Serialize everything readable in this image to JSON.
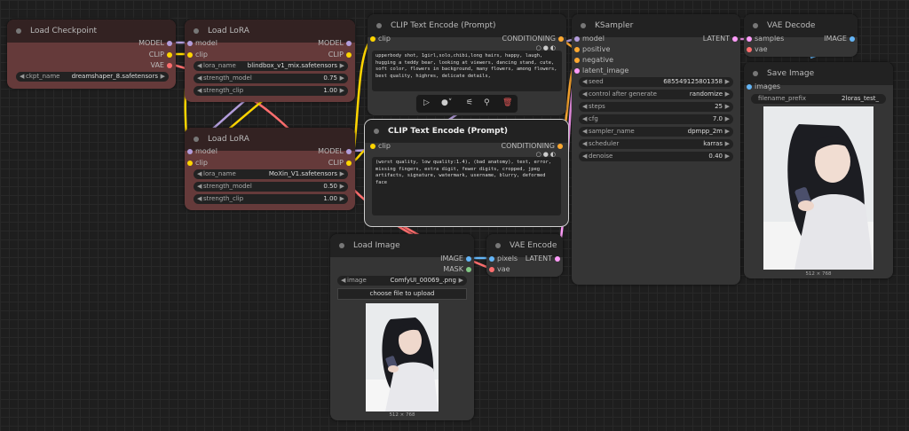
{
  "colors": {
    "model": "#b39ddb",
    "clip": "#ffd500",
    "vae": "#ff6e6e",
    "conditioning": "#ffa931",
    "latent": "#ff9cf9",
    "image": "#64b5f6",
    "mask": "#81c784"
  },
  "load_checkpoint": {
    "title": "Load Checkpoint",
    "outputs": [
      "MODEL",
      "CLIP",
      "VAE"
    ],
    "ckpt_label": "ckpt_name",
    "ckpt_value": "dreamshaper_8.safetensors"
  },
  "lora1": {
    "title": "Load LoRA",
    "inputs": [
      "model",
      "clip"
    ],
    "outputs": [
      "MODEL",
      "CLIP"
    ],
    "w": [
      {
        "label": "lora_name",
        "value": "blindbox_v1_mix.safetensors"
      },
      {
        "label": "strength_model",
        "value": "0.75"
      },
      {
        "label": "strength_clip",
        "value": "1.00"
      }
    ]
  },
  "lora2": {
    "title": "Load LoRA",
    "inputs": [
      "model",
      "clip"
    ],
    "outputs": [
      "MODEL",
      "CLIP"
    ],
    "w": [
      {
        "label": "lora_name",
        "value": "MoXin_V1.safetensors"
      },
      {
        "label": "strength_model",
        "value": "0.50"
      },
      {
        "label": "strength_clip",
        "value": "1.00"
      }
    ]
  },
  "clip_pos": {
    "title": "CLIP Text Encode (Prompt)",
    "input": "clip",
    "output": "CONDITIONING",
    "text": "upperbody shot, 1girl,solo,chibi,long hairs, happy, laugh, hugging a teddy bear, looking at viewers, dancing stand, cute, soft color, flowers in background, many flowers, among flowers, best quality, highres, delicate details,"
  },
  "clip_neg": {
    "title": "CLIP Text Encode (Prompt)",
    "input": "clip",
    "output": "CONDITIONING",
    "text": "(worst quality, low quality:1.4), (bad anatomy), text, error, missing fingers, extra digit, fewer digits, cropped, jpeg artifacts, signature, watermark, username, blurry, deformed face"
  },
  "ksampler": {
    "title": "KSampler",
    "inputs": [
      "model",
      "positive",
      "negative",
      "latent_image"
    ],
    "output": "LATENT",
    "w": [
      {
        "label": "seed",
        "value": "685549125801358"
      },
      {
        "label": "control after generate",
        "value": "randomize"
      },
      {
        "label": "steps",
        "value": "25"
      },
      {
        "label": "cfg",
        "value": "7.0"
      },
      {
        "label": "sampler_name",
        "value": "dpmpp_2m"
      },
      {
        "label": "scheduler",
        "value": "karras"
      },
      {
        "label": "denoise",
        "value": "0.40"
      }
    ]
  },
  "vae_decode": {
    "title": "VAE Decode",
    "inputs": [
      "samples",
      "vae"
    ],
    "output": "IMAGE"
  },
  "save_image": {
    "title": "Save Image",
    "input": "images",
    "prefix_label": "filename_prefix",
    "prefix_value": "2loras_test_",
    "caption": "512 × 768"
  },
  "load_image": {
    "title": "Load Image",
    "outputs": [
      "IMAGE",
      "MASK"
    ],
    "image_label": "image",
    "image_value": "ComfyUI_00069_.png",
    "upload": "choose file to upload",
    "caption": "512 × 768"
  },
  "vae_encode": {
    "title": "VAE Encode",
    "inputs": [
      "pixels",
      "vae"
    ],
    "output": "LATENT"
  }
}
